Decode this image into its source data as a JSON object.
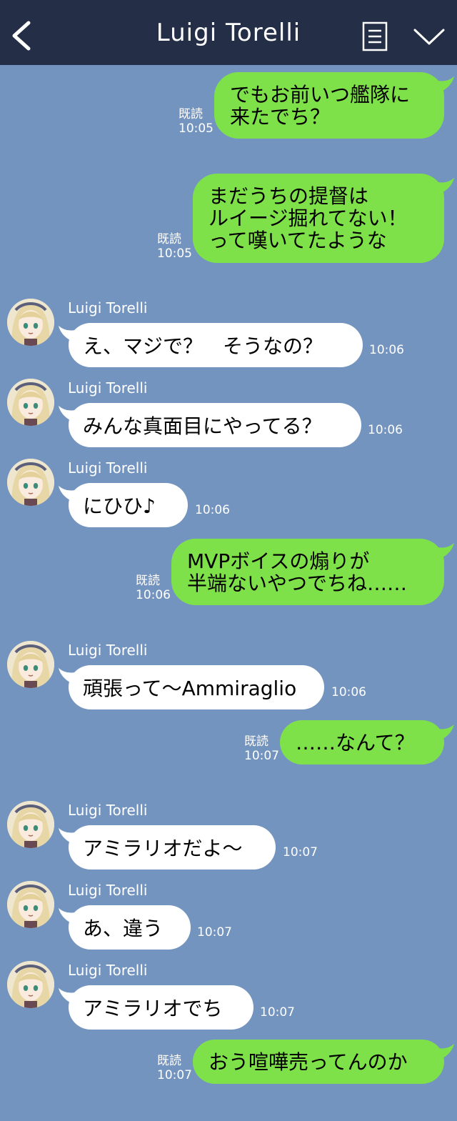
{
  "header": {
    "title": "Luigi Torelli"
  },
  "colors": {
    "header_bg": "#242f47",
    "chat_bg": "#7494c0",
    "out_bubble": "#7fe14a",
    "in_bubble": "#ffffff"
  },
  "icons": {
    "back": "chevron-left-icon",
    "menu": "menu-lines-icon",
    "collapse": "chevron-down-icon"
  },
  "messages": [
    {
      "dir": "out",
      "read": "既読",
      "time": "10:05",
      "lines": [
        "でもお前いつ艦隊に",
        "来たでち？"
      ]
    },
    {
      "dir": "out",
      "read": "既読",
      "time": "10:05",
      "lines": [
        "まだうちの提督は",
        "ルイージ掘れてない！",
        "って嘆いてたような"
      ]
    },
    {
      "dir": "in",
      "sender": "Luigi Torelli",
      "time": "10:06",
      "text": "え、マジで？　そうなの？"
    },
    {
      "dir": "in",
      "sender": "Luigi Torelli",
      "time": "10:06",
      "text": "みんな真面目にやってる？"
    },
    {
      "dir": "in",
      "sender": "Luigi Torelli",
      "time": "10:06",
      "text": "にひひ♪"
    },
    {
      "dir": "out",
      "read": "既読",
      "time": "10:06",
      "lines": [
        "MVPボイスの煽りが",
        "半端ないやつでちね……"
      ]
    },
    {
      "dir": "in",
      "sender": "Luigi Torelli",
      "time": "10:06",
      "text": "頑張って〜Ammiraglio"
    },
    {
      "dir": "out",
      "read": "既読",
      "time": "10:07",
      "lines": [
        "……なんて？"
      ]
    },
    {
      "dir": "in",
      "sender": "Luigi Torelli",
      "time": "10:07",
      "text": "アミラリオだよ〜"
    },
    {
      "dir": "in",
      "sender": "Luigi Torelli",
      "time": "10:07",
      "text": "あ、違う"
    },
    {
      "dir": "in",
      "sender": "Luigi Torelli",
      "time": "10:07",
      "text": "アミラリオでち"
    },
    {
      "dir": "out",
      "read": "既読",
      "time": "10:07",
      "lines": [
        "おう喧嘩売ってんのか"
      ]
    }
  ]
}
